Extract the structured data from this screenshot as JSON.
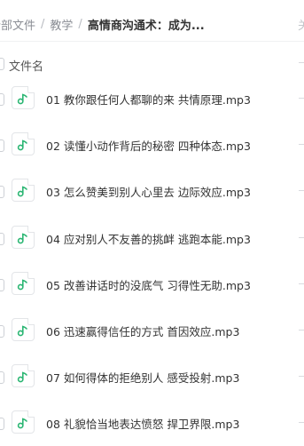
{
  "breadcrumb": {
    "items": [
      "全部文件",
      "教学"
    ],
    "separator": "/",
    "current": "高情商沟通术：成为..."
  },
  "top_right_glyph": "关",
  "list_header": {
    "name_label": "文件名"
  },
  "files": [
    {
      "name": "01 教你跟任何人都聊的来 共情原理.mp3"
    },
    {
      "name": "02 读懂小动作背后的秘密 四种体态.mp3"
    },
    {
      "name": "03 怎么赞美到别人心里去 边际效应.mp3"
    },
    {
      "name": "04 应对别人不友善的挑衅 逃跑本能.mp3"
    },
    {
      "name": "05 改善讲话时的没底气 习得性无助.mp3"
    },
    {
      "name": "06 迅速赢得信任的方式 首因效应.mp3"
    },
    {
      "name": "07 如何得体的拒绝别人 感受投射.mp3"
    },
    {
      "name": "08 礼貌恰当地表达愤怒 捍卫界限.mp3"
    }
  ],
  "colors": {
    "audio_icon": "#2bb673",
    "text": "#333333",
    "muted": "#8a8d94"
  }
}
